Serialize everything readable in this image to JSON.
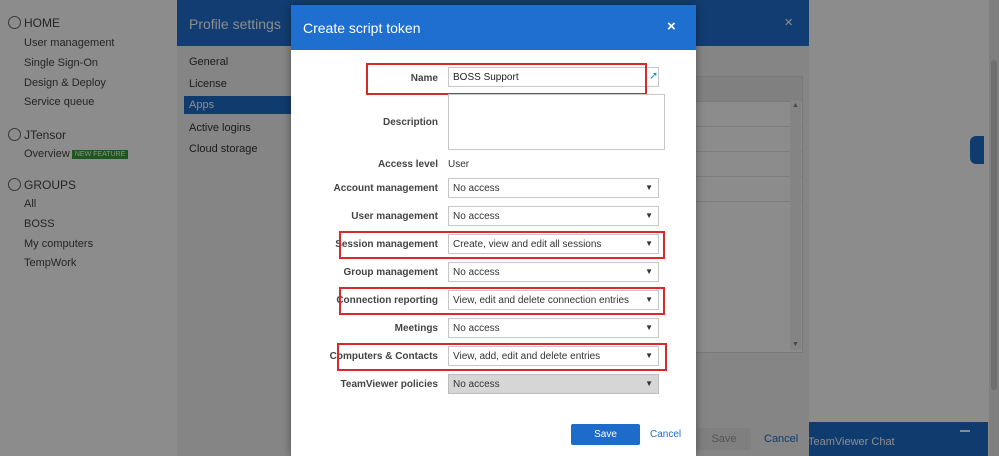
{
  "background": {
    "sidebar": {
      "home_heading": "HOME",
      "home_items": [
        "User management",
        "Single Sign-On",
        "Design & Deploy",
        "Service queue"
      ],
      "tensor_heading": "JTensor",
      "overview_item": "Overview",
      "new_badge": "NEW FEATURE",
      "groups_heading": "GROUPS",
      "group_items": [
        "All",
        "BOSS",
        "My computers",
        "TempWork"
      ]
    },
    "teamviewer_chat": "TeamViewer Chat"
  },
  "profile_settings": {
    "title": "Profile settings",
    "nav_items": [
      "General",
      "License",
      "Apps",
      "Active logins",
      "Cloud storage"
    ],
    "active_nav": "Apps",
    "footer_save": "Save",
    "footer_cancel": "Cancel"
  },
  "dialog": {
    "title": "Create script token",
    "close_label": "×",
    "name_label": "Name",
    "name_value": "BOSS Support",
    "description_label": "Description",
    "description_value": "",
    "access_level_label": "Access level",
    "access_level_value": "User",
    "fields": [
      {
        "label": "Account management",
        "value": "No access"
      },
      {
        "label": "User management",
        "value": "No access"
      },
      {
        "label": "Session management",
        "value": "Create, view and edit all sessions"
      },
      {
        "label": "Group management",
        "value": "No access"
      },
      {
        "label": "Connection reporting",
        "value": "View, edit and delete connection entries"
      },
      {
        "label": "Meetings",
        "value": "No access"
      },
      {
        "label": "Computers & Contacts",
        "value": "View, add, edit and delete entries"
      },
      {
        "label": "TeamViewer policies",
        "value": "No access",
        "disabled": true
      }
    ],
    "save_label": "Save",
    "cancel_label": "Cancel"
  },
  "colors": {
    "accent": "#1f6fd0",
    "highlight": "#d92a2a"
  },
  "icons": {
    "dropdown": "chevron-down-icon",
    "name_field": "user-icon",
    "close": "close-icon"
  }
}
